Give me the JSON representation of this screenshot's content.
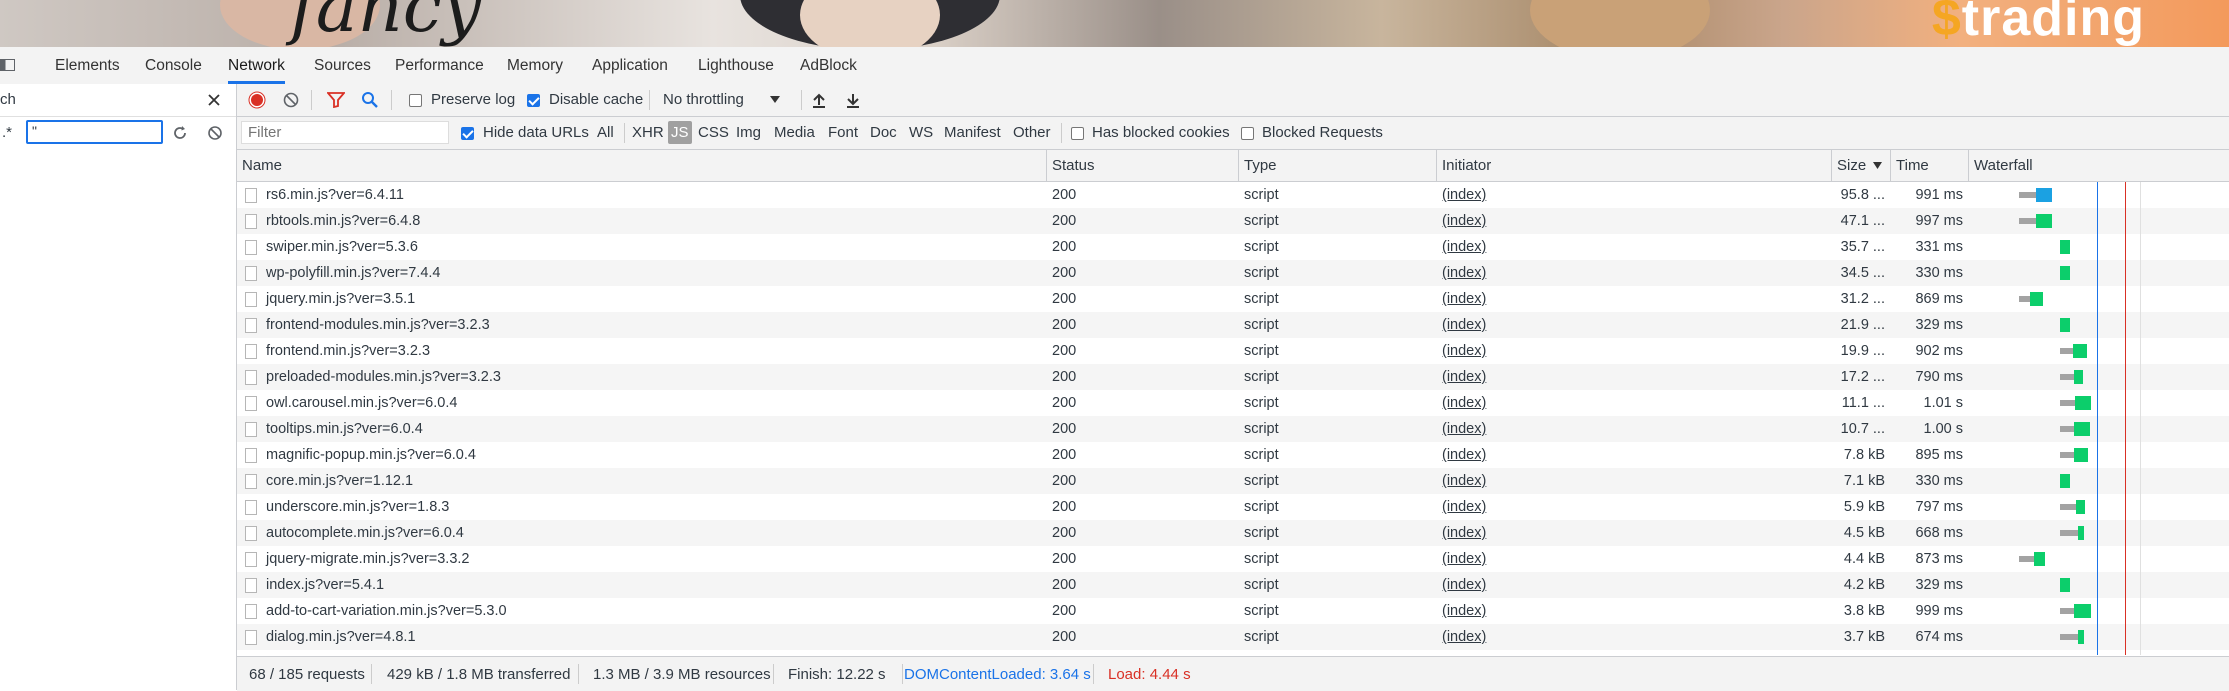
{
  "banner": {
    "brand_text": "trading",
    "brand_mark": "$"
  },
  "tabs": [
    "Elements",
    "Console",
    "Network",
    "Sources",
    "Performance",
    "Memory",
    "Application",
    "Lighthouse",
    "AdBlock"
  ],
  "active_tab": "Network",
  "sidebar": {
    "search_partial": "ch",
    "regex_label": ".*",
    "search_value": "\""
  },
  "toolbar": {
    "preserve_log": "Preserve log",
    "disable_cache": "Disable cache",
    "throttling": "No throttling"
  },
  "filterbar": {
    "filter_placeholder": "Filter",
    "hide_data_urls": "Hide data URLs",
    "types": [
      "All",
      "XHR",
      "JS",
      "CSS",
      "Img",
      "Media",
      "Font",
      "Doc",
      "WS",
      "Manifest",
      "Other"
    ],
    "selected_type": "JS",
    "has_blocked_cookies": "Has blocked cookies",
    "blocked_requests": "Blocked Requests"
  },
  "columns": {
    "name": "Name",
    "status": "Status",
    "type": "Type",
    "initiator": "Initiator",
    "size": "Size",
    "time": "Time",
    "waterfall": "Waterfall"
  },
  "rows": [
    {
      "name": "rs6.min.js?ver=6.4.11",
      "status": "200",
      "type": "script",
      "initiator": "(index)",
      "size": "95.8 ...",
      "time": "991 ms",
      "color": "#1ba1e2"
    },
    {
      "name": "rbtools.min.js?ver=6.4.8",
      "status": "200",
      "type": "script",
      "initiator": "(index)",
      "size": "47.1 ...",
      "time": "997 ms",
      "color": "#0cce6b"
    },
    {
      "name": "swiper.min.js?ver=5.3.6",
      "status": "200",
      "type": "script",
      "initiator": "(index)",
      "size": "35.7 ...",
      "time": "331 ms",
      "color": "#0cce6b"
    },
    {
      "name": "wp-polyfill.min.js?ver=7.4.4",
      "status": "200",
      "type": "script",
      "initiator": "(index)",
      "size": "34.5 ...",
      "time": "330 ms",
      "color": "#0cce6b"
    },
    {
      "name": "jquery.min.js?ver=3.5.1",
      "status": "200",
      "type": "script",
      "initiator": "(index)",
      "size": "31.2 ...",
      "time": "869 ms",
      "color": "#0cce6b"
    },
    {
      "name": "frontend-modules.min.js?ver=3.2.3",
      "status": "200",
      "type": "script",
      "initiator": "(index)",
      "size": "21.9 ...",
      "time": "329 ms",
      "color": "#0cce6b"
    },
    {
      "name": "frontend.min.js?ver=3.2.3",
      "status": "200",
      "type": "script",
      "initiator": "(index)",
      "size": "19.9 ...",
      "time": "902 ms",
      "color": "#0cce6b"
    },
    {
      "name": "preloaded-modules.min.js?ver=3.2.3",
      "status": "200",
      "type": "script",
      "initiator": "(index)",
      "size": "17.2 ...",
      "time": "790 ms",
      "color": "#0cce6b"
    },
    {
      "name": "owl.carousel.min.js?ver=6.0.4",
      "status": "200",
      "type": "script",
      "initiator": "(index)",
      "size": "11.1 ...",
      "time": "1.01 s",
      "color": "#0cce6b"
    },
    {
      "name": "tooltips.min.js?ver=6.0.4",
      "status": "200",
      "type": "script",
      "initiator": "(index)",
      "size": "10.7 ...",
      "time": "1.00 s",
      "color": "#0cce6b"
    },
    {
      "name": "magnific-popup.min.js?ver=6.0.4",
      "status": "200",
      "type": "script",
      "initiator": "(index)",
      "size": "7.8 kB",
      "time": "895 ms",
      "color": "#0cce6b"
    },
    {
      "name": "core.min.js?ver=1.12.1",
      "status": "200",
      "type": "script",
      "initiator": "(index)",
      "size": "7.1 kB",
      "time": "330 ms",
      "color": "#0cce6b"
    },
    {
      "name": "underscore.min.js?ver=1.8.3",
      "status": "200",
      "type": "script",
      "initiator": "(index)",
      "size": "5.9 kB",
      "time": "797 ms",
      "color": "#0cce6b"
    },
    {
      "name": "autocomplete.min.js?ver=6.0.4",
      "status": "200",
      "type": "script",
      "initiator": "(index)",
      "size": "4.5 kB",
      "time": "668 ms",
      "color": "#0cce6b"
    },
    {
      "name": "jquery-migrate.min.js?ver=3.3.2",
      "status": "200",
      "type": "script",
      "initiator": "(index)",
      "size": "4.4 kB",
      "time": "873 ms",
      "color": "#0cce6b"
    },
    {
      "name": "index.js?ver=5.4.1",
      "status": "200",
      "type": "script",
      "initiator": "(index)",
      "size": "4.2 kB",
      "time": "329 ms",
      "color": "#0cce6b"
    },
    {
      "name": "add-to-cart-variation.min.js?ver=5.3.0",
      "status": "200",
      "type": "script",
      "initiator": "(index)",
      "size": "3.8 kB",
      "time": "999 ms",
      "color": "#0cce6b"
    },
    {
      "name": "dialog.min.js?ver=4.8.1",
      "status": "200",
      "type": "script",
      "initiator": "(index)",
      "size": "3.7 kB",
      "time": "674 ms",
      "color": "#0cce6b"
    }
  ],
  "status": {
    "requests": "68 / 185 requests",
    "transferred": "429 kB / 1.8 MB transferred",
    "resources": "1.3 MB / 3.9 MB resources",
    "finish": "Finish: 12.22 s",
    "dom_content_loaded": "DOMContentLoaded: 3.64 s",
    "load": "Load: 4.44 s"
  },
  "colors": {
    "accent": "#1a73e8",
    "record_red": "#d93025",
    "dcl_blue": "#1a73e8",
    "load_red": "#d93025"
  }
}
